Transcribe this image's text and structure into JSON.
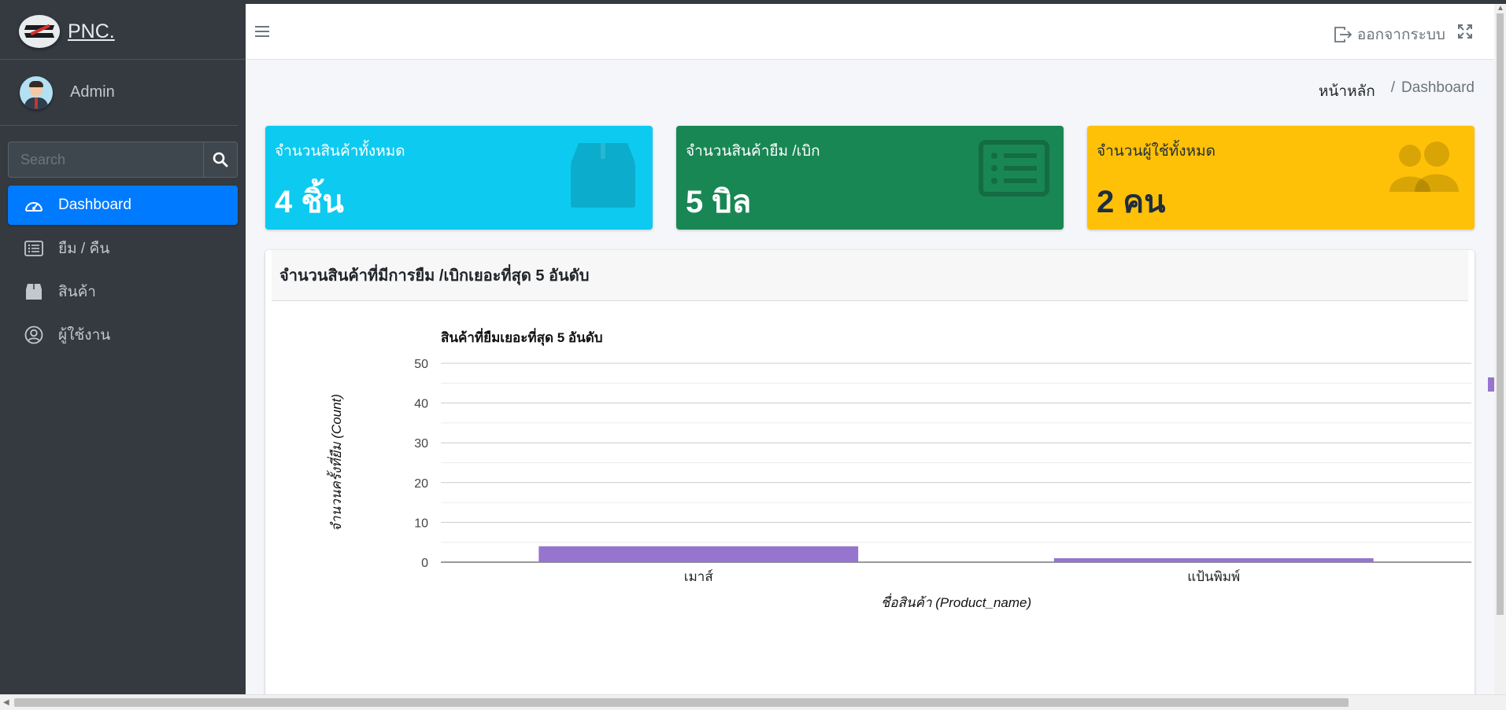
{
  "brand": {
    "name": "PNC."
  },
  "user": {
    "name": "Admin"
  },
  "search": {
    "placeholder": "Search"
  },
  "sidebar": {
    "items": [
      {
        "label": "Dashboard",
        "icon": "dashboard-icon",
        "active": true
      },
      {
        "label": "ยืม / คืน",
        "icon": "list-icon",
        "active": false
      },
      {
        "label": "สินค้า",
        "icon": "box-icon",
        "active": false
      },
      {
        "label": "ผู้ใช้งาน",
        "icon": "user-circle-icon",
        "active": false
      }
    ]
  },
  "navbar": {
    "logout_label": "ออกจากระบบ"
  },
  "breadcrumb": {
    "home": "หน้าหลัก",
    "separator": "/",
    "current": "Dashboard"
  },
  "stats": [
    {
      "label": "จำนวนสินค้าทั้งหมด",
      "value": "4 ชิ้น",
      "icon": "box-icon",
      "color": "#0dcaf0"
    },
    {
      "label": "จำนวนสินค้ายืม /เบิก",
      "value": "5 บิล",
      "icon": "list-icon",
      "color": "#198754"
    },
    {
      "label": "จำนวนผู้ใช้ทั้งหมด",
      "value": "2 คน",
      "icon": "users-icon",
      "color": "#ffc107"
    }
  ],
  "card": {
    "title": "จำนวนสินค้าที่มีการยืม /เบิกเยอะที่สุด 5 อันดับ"
  },
  "chart_data": {
    "type": "bar",
    "title": "สินค้าที่ยืมเยอะที่สุด 5 อันดับ",
    "xlabel": "ชื่อสินค้า (Product_name)",
    "ylabel": "จำนวนครั้งที่ยืม (Count)",
    "categories": [
      "เมาส์",
      "แป้นพิมพ์"
    ],
    "values": [
      4,
      1
    ],
    "ylim": [
      0,
      50
    ],
    "yticks": [
      0,
      10,
      20,
      30,
      40,
      50
    ],
    "grid": true,
    "bar_color": "#9575cd"
  }
}
